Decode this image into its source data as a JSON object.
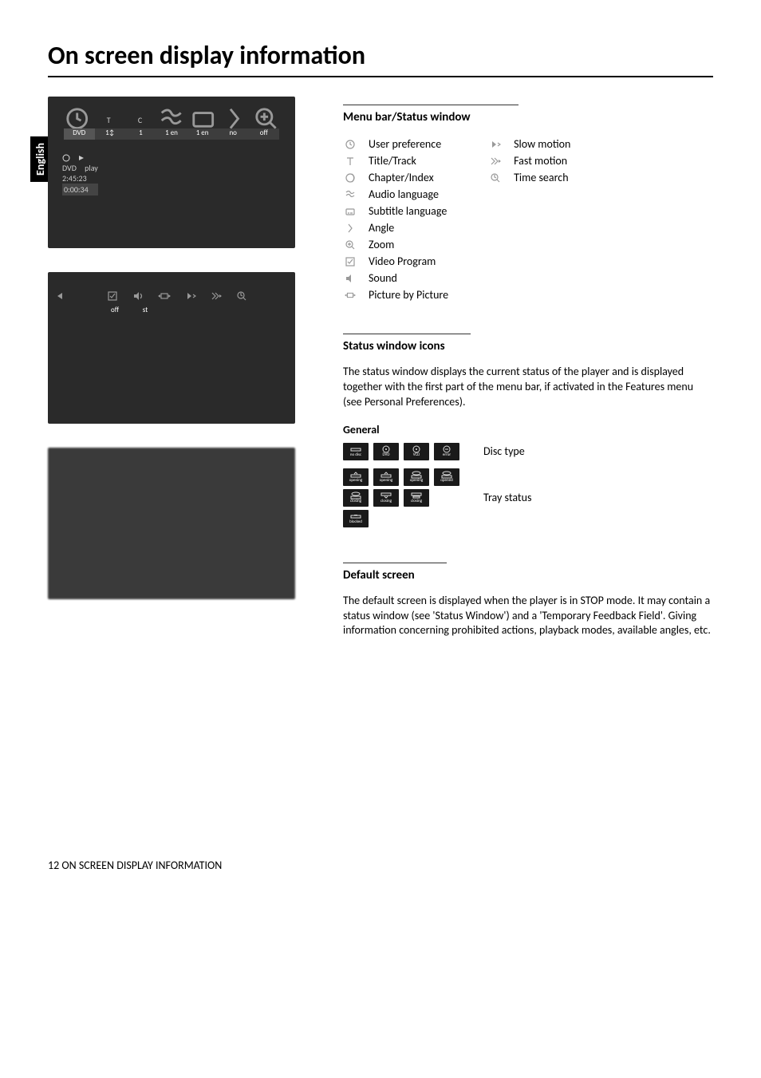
{
  "page_title": "On screen display information",
  "language_tab": "English",
  "footer": "12 ON SCREEN DISPLAY INFORMATION",
  "menu_bar": {
    "heading": "Menu bar/Status window",
    "left_items": [
      "User preference",
      "Title/Track",
      "Chapter/Index",
      "Audio language",
      "Subtitle language",
      "Angle",
      "Zoom",
      "Video Program",
      "Sound",
      "Picture by Picture"
    ],
    "right_items": [
      "Slow motion",
      "Fast motion",
      "Time search"
    ]
  },
  "status_icons": {
    "heading": "Status window icons",
    "intro": "The status window displays the current status of the player and is displayed together with the first part of the menu bar, if activated in the Features menu (see Personal Preferences).",
    "general_head": "General",
    "disc_type_label": "Disc type",
    "tray_status_label": "Tray status",
    "disc_type_icons": [
      "no disc",
      "DVD",
      "VCD",
      "error"
    ],
    "tray_icons_row1": [
      "opening",
      "opening",
      "opening",
      "opened"
    ],
    "tray_icons_row2": [
      "closing",
      "closing",
      "closing"
    ],
    "tray_icons_row3": [
      "blocked"
    ]
  },
  "default_screen": {
    "heading": "Default screen",
    "para": "The default screen is displayed when the player is in STOP mode. It may contain a status window (see 'Status Window') and a 'Temporary Feedback Field'. Giving information concerning prohibited actions, playback modes, available angles, etc."
  },
  "screenshot1": {
    "glyphs": [
      "",
      "T",
      "C",
      "",
      "",
      "",
      ""
    ],
    "vals": [
      "",
      "1↕",
      "1",
      "1 en",
      "1 en",
      "no",
      "off"
    ],
    "status_dvd": "DVD",
    "status_play": "play",
    "status_total": "2:45:23",
    "status_elapsed": "0:00:34"
  },
  "screenshot2": {
    "vals": [
      "off",
      "st"
    ]
  }
}
